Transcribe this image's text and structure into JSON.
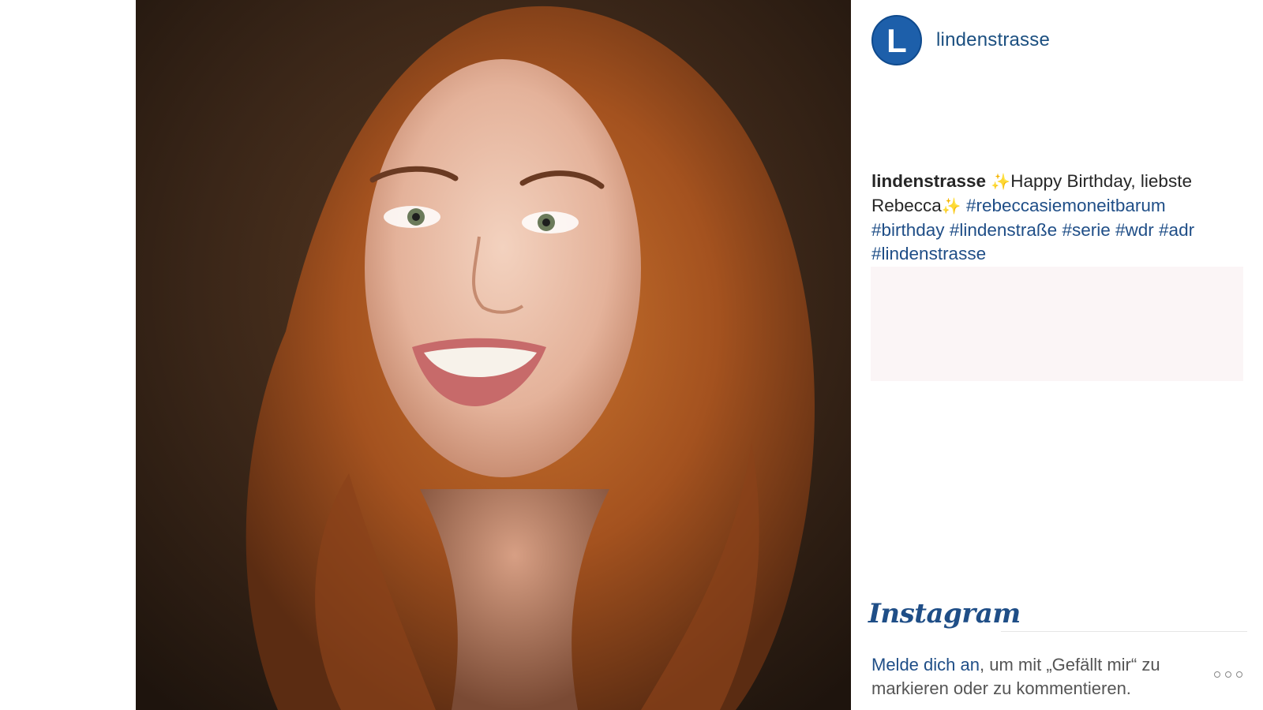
{
  "account": {
    "username": "lindenstrasse",
    "avatar_letter": "L",
    "avatar_color": "#1d5faa"
  },
  "caption": {
    "username": "lindenstrasse",
    "sparkle_1": "✨",
    "text_1": "Happy Birthday, liebste Rebecca",
    "sparkle_2": "✨",
    "hashtags": [
      "#rebeccasiemoneitbarum",
      "#birthday",
      "#lindenstraße",
      "#serie",
      "#wdr",
      "#adr",
      "#lindenstrasse"
    ]
  },
  "brand": {
    "name": "Instagram",
    "color": "#1f4e87"
  },
  "footer": {
    "login_link": "Melde dich an",
    "login_rest": ", um mit „Gefällt mir“ zu markieren oder zu kommentieren.",
    "more_icon": "more-dots-icon"
  },
  "colors": {
    "link": "#1f4e87",
    "text": "#262626",
    "muted": "#555555",
    "pink_box": "#fbf5f6"
  }
}
